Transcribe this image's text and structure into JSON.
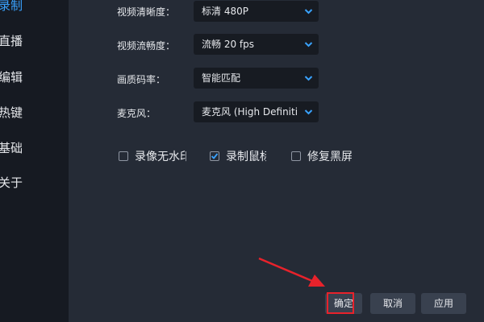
{
  "sidebar": {
    "items": [
      {
        "label": "录制",
        "active": true
      },
      {
        "label": "直播",
        "active": false
      },
      {
        "label": "编辑",
        "active": false
      },
      {
        "label": "热键",
        "active": false
      },
      {
        "label": "基础",
        "active": false
      },
      {
        "label": "关于",
        "active": false
      }
    ]
  },
  "settings": {
    "video_clarity": {
      "label": "视频清晰度：",
      "value": "标清 480P"
    },
    "video_fluency": {
      "label": "视频流畅度：",
      "value": "流畅 20 fps"
    },
    "bitrate": {
      "label": "画质码率：",
      "value": "智能匹配"
    },
    "microphone": {
      "label": "麦克风：",
      "value": "麦克风 (High Definition"
    }
  },
  "checkboxes": [
    {
      "label": "录像无水印",
      "checked": false
    },
    {
      "label": "录制鼠标",
      "checked": true
    },
    {
      "label": "修复黑屏",
      "checked": false
    }
  ],
  "buttons": {
    "confirm": "确定",
    "cancel": "取消",
    "apply": "应用"
  },
  "colors": {
    "accent": "#39a2ff",
    "annotation": "#e8222b"
  }
}
